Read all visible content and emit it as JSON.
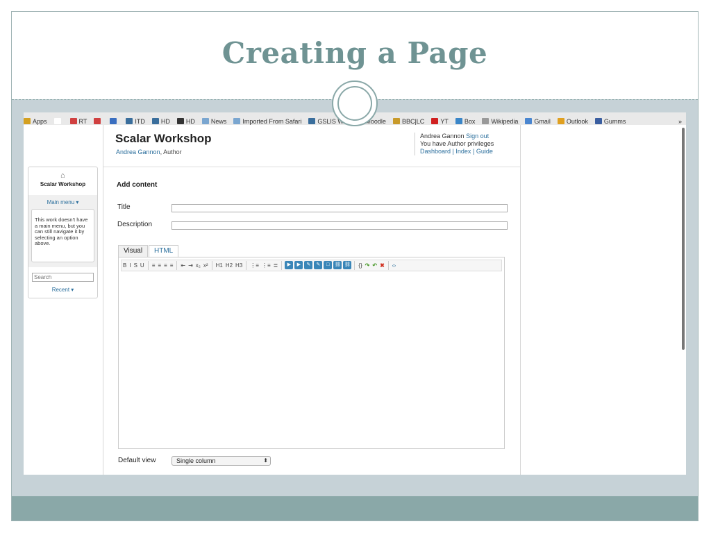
{
  "slide": {
    "title": "Creating a Page"
  },
  "bookmarks": {
    "items": [
      {
        "label": "Apps",
        "color": "#d4a020"
      },
      {
        "label": "",
        "color": "#ffffff"
      },
      {
        "label": "RT",
        "color": "#d04040"
      },
      {
        "label": "",
        "color": "#d04040"
      },
      {
        "label": "",
        "color": "#3a6ec0"
      },
      {
        "label": "ITD",
        "color": "#3a6e9c"
      },
      {
        "label": "HD",
        "color": "#3a6e9c"
      },
      {
        "label": "HD",
        "color": "#333333"
      },
      {
        "label": "News",
        "color": "#7aa6d0"
      },
      {
        "label": "Imported From Safari",
        "color": "#7aa6d0"
      },
      {
        "label": "GSLIS Wiki",
        "color": "#3a6e9c"
      },
      {
        "label": "Moodle",
        "color": "#333333"
      },
      {
        "label": "BBC|LC",
        "color": "#c89a2a"
      },
      {
        "label": "YT",
        "color": "#d02020"
      },
      {
        "label": "Box",
        "color": "#3a86c8"
      },
      {
        "label": "Wikipedia",
        "color": "#999999"
      },
      {
        "label": "Gmail",
        "color": "#4a86d0"
      },
      {
        "label": "Outlook",
        "color": "#e0a020"
      },
      {
        "label": "Gumms",
        "color": "#3a5ea0"
      }
    ],
    "more": "»"
  },
  "header": {
    "work_title": "Scalar Workshop",
    "author_name": "Andrea Gannon",
    "author_role": ", Author",
    "user_name": "Andrea Gannon",
    "sign_out": "Sign out",
    "privileges": "You have Author privileges",
    "dashboard": "Dashboard",
    "sep": "|",
    "index": "Index",
    "guide": "Guide"
  },
  "sidebar": {
    "home_icon": "⌂",
    "book_title": "Scalar Workshop",
    "main_menu": "Main menu ▾",
    "notice": "This work doesn't have a main menu, but you can still navigate it by selecting an option above.",
    "search_placeholder": "Search",
    "recent": "Recent ▾"
  },
  "form": {
    "heading": "Add content",
    "title_label": "Title",
    "title_value": "",
    "description_label": "Description",
    "description_value": "",
    "tab_visual": "Visual",
    "tab_html": "HTML",
    "default_view_label": "Default view",
    "default_view_value": "Single column",
    "default_view_arrow": "⬍"
  },
  "toolbar": {
    "buttons": [
      {
        "name": "bold-button",
        "label": "B"
      },
      {
        "name": "italic-button",
        "label": "I"
      },
      {
        "name": "strike-button",
        "label": "S"
      },
      {
        "name": "underline-button",
        "label": "U"
      },
      {
        "sep": true
      },
      {
        "name": "align-left-button",
        "label": "≡"
      },
      {
        "name": "align-center-button",
        "label": "≡"
      },
      {
        "name": "align-right-button",
        "label": "≡"
      },
      {
        "name": "align-justify-button",
        "label": "≡"
      },
      {
        "sep": true
      },
      {
        "name": "outdent-button",
        "label": "⇤"
      },
      {
        "name": "indent-button",
        "label": "⇥"
      },
      {
        "name": "subscript-button",
        "label": "x₂"
      },
      {
        "name": "superscript-button",
        "label": "x²"
      },
      {
        "sep": true
      },
      {
        "name": "h1-button",
        "label": "H1"
      },
      {
        "name": "h2-button",
        "label": "H2"
      },
      {
        "name": "h3-button",
        "label": "H3"
      },
      {
        "sep": true
      },
      {
        "name": "ordered-list-button",
        "label": "⋮≡"
      },
      {
        "name": "bullet-list-button",
        "label": "⋮≡"
      },
      {
        "name": "blockquote-button",
        "label": "≣"
      },
      {
        "sep": true
      },
      {
        "name": "insert-media-link-button",
        "label": "▶",
        "style": "blue"
      },
      {
        "name": "insert-inline-media-button",
        "label": "▶",
        "style": "blue"
      },
      {
        "name": "insert-note-button",
        "label": "✎",
        "style": "blue"
      },
      {
        "name": "insert-annotation-button",
        "label": "✎",
        "style": "blue"
      },
      {
        "name": "insert-widget-button",
        "label": "□",
        "style": "blue"
      },
      {
        "name": "insert-link-button",
        "label": "⛓",
        "style": "blue"
      },
      {
        "name": "unlink-button",
        "label": "⛓",
        "style": "blue"
      },
      {
        "sep": true
      },
      {
        "name": "insert-code-button",
        "label": "{}"
      },
      {
        "name": "redo-button",
        "label": "↷",
        "style": "green"
      },
      {
        "name": "undo-button",
        "label": "↶",
        "style": "green"
      },
      {
        "name": "remove-format-button",
        "label": "✖",
        "style": "red"
      },
      {
        "sep": true
      },
      {
        "name": "source-code-button",
        "label": "‹›",
        "style": "code"
      }
    ]
  }
}
